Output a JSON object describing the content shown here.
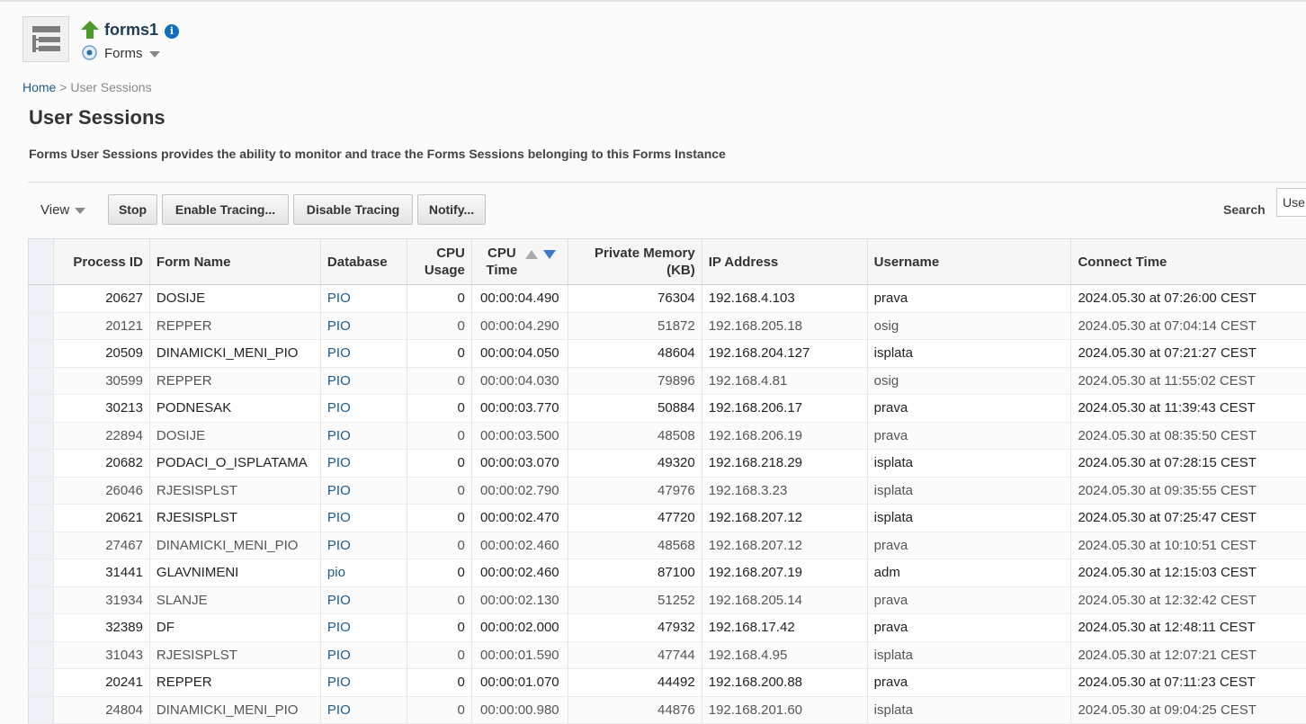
{
  "header": {
    "target_name": "forms1",
    "target_type": "Forms"
  },
  "breadcrumb": {
    "home": "Home",
    "separator": ">",
    "current": "User Sessions"
  },
  "page": {
    "title": "User Sessions",
    "description": "Forms User Sessions provides the ability to monitor and trace the Forms Sessions belonging to this Forms Instance"
  },
  "toolbar": {
    "view_label": "View",
    "buttons": [
      "Stop",
      "Enable Tracing...",
      "Disable Tracing",
      "Notify..."
    ],
    "search_label": "Search",
    "search_value": "Use"
  },
  "table": {
    "columns": [
      "Process ID",
      "Form Name",
      "Database",
      "CPU Usage",
      "CPU Time",
      "Private Memory (KB)",
      "IP Address",
      "Username",
      "Connect Time"
    ],
    "sorted_column": "CPU Time",
    "sort_direction": "descending",
    "rows": [
      [
        "20627",
        "DOSIJE",
        "PIO",
        "0",
        "00:00:04.490",
        "76304",
        "192.168.4.103",
        "prava",
        "2024.05.30 at 07:26:00 CEST"
      ],
      [
        "20121",
        "REPPER",
        "PIO",
        "0",
        "00:00:04.290",
        "51872",
        "192.168.205.18",
        "osig",
        "2024.05.30 at 07:04:14 CEST"
      ],
      [
        "20509",
        "DINAMICKI_MENI_PIO",
        "PIO",
        "0",
        "00:00:04.050",
        "48604",
        "192.168.204.127",
        "isplata",
        "2024.05.30 at 07:21:27 CEST"
      ],
      [
        "30599",
        "REPPER",
        "PIO",
        "0",
        "00:00:04.030",
        "79896",
        "192.168.4.81",
        "osig",
        "2024.05.30 at 11:55:02 CEST"
      ],
      [
        "30213",
        "PODNESAK",
        "PIO",
        "0",
        "00:00:03.770",
        "50884",
        "192.168.206.17",
        "prava",
        "2024.05.30 at 11:39:43 CEST"
      ],
      [
        "22894",
        "DOSIJE",
        "PIO",
        "0",
        "00:00:03.500",
        "48508",
        "192.168.206.19",
        "prava",
        "2024.05.30 at 08:35:50 CEST"
      ],
      [
        "20682",
        "PODACI_O_ISPLATAMA",
        "PIO",
        "0",
        "00:00:03.070",
        "49320",
        "192.168.218.29",
        "isplata",
        "2024.05.30 at 07:28:15 CEST"
      ],
      [
        "26046",
        "RJESISPLST",
        "PIO",
        "0",
        "00:00:02.790",
        "47976",
        "192.168.3.23",
        "isplata",
        "2024.05.30 at 09:35:55 CEST"
      ],
      [
        "20621",
        "RJESISPLST",
        "PIO",
        "0",
        "00:00:02.470",
        "47720",
        "192.168.207.12",
        "isplata",
        "2024.05.30 at 07:25:47 CEST"
      ],
      [
        "27467",
        "DINAMICKI_MENI_PIO",
        "PIO",
        "0",
        "00:00:02.460",
        "48568",
        "192.168.207.12",
        "prava",
        "2024.05.30 at 10:10:51 CEST"
      ],
      [
        "31441",
        "GLAVNIMENI",
        "pio",
        "0",
        "00:00:02.460",
        "87100",
        "192.168.207.19",
        "adm",
        "2024.05.30 at 12:15:03 CEST"
      ],
      [
        "31934",
        "SLANJE",
        "PIO",
        "0",
        "00:00:02.130",
        "51252",
        "192.168.205.14",
        "prava",
        "2024.05.30 at 12:32:42 CEST"
      ],
      [
        "32389",
        "DF",
        "PIO",
        "0",
        "00:00:02.000",
        "47932",
        "192.168.17.42",
        "prava",
        "2024.05.30 at 12:48:11 CEST"
      ],
      [
        "31043",
        "RJESISPLST",
        "PIO",
        "0",
        "00:00:01.590",
        "47744",
        "192.168.4.95",
        "isplata",
        "2024.05.30 at 12:07:21 CEST"
      ],
      [
        "20241",
        "REPPER",
        "PIO",
        "0",
        "00:00:01.070",
        "44492",
        "192.168.200.88",
        "prava",
        "2024.05.30 at 07:11:23 CEST"
      ],
      [
        "24804",
        "DINAMICKI_MENI_PIO",
        "PIO",
        "0",
        "00:00:00.980",
        "44876",
        "192.168.201.60",
        "isplata",
        "2024.05.30 at 09:04:25 CEST"
      ]
    ]
  },
  "colors": {
    "link": "#1d5a8e",
    "target_name": "#1d3c58",
    "status_up": "#4c9a2a",
    "info_icon": "#0f6fbd",
    "sort_active": "#3a78c9"
  }
}
